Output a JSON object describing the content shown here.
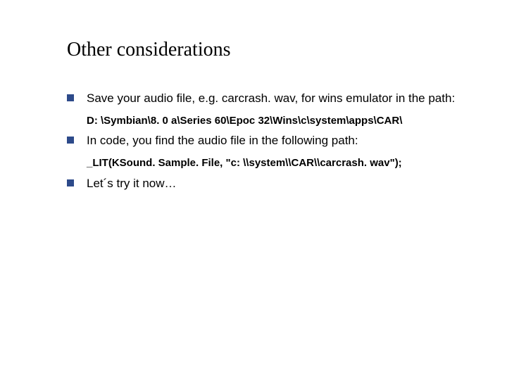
{
  "title": "Other considerations",
  "items": [
    {
      "text": "Save your audio file, e.g. carcrash. wav, for wins emulator in the path:",
      "sub": "D: \\Symbian\\8. 0 a\\Series 60\\Epoc 32\\Wins\\c\\system\\apps\\CAR\\"
    },
    {
      "text": "In code, you find the audio file in the following path:",
      "sub": "_LIT(KSound. Sample. File, \"c: \\\\system\\\\CAR\\\\carcrash. wav\");"
    },
    {
      "text": "Let´s try it now…",
      "sub": null
    }
  ],
  "colors": {
    "bullet": "#2d4a8a"
  }
}
